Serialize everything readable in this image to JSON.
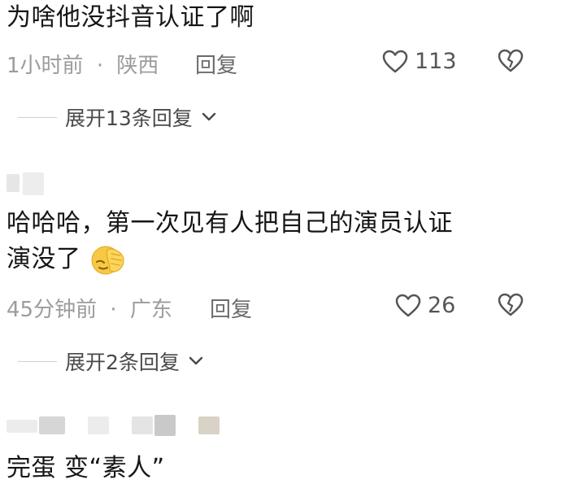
{
  "comments": [
    {
      "text": "为啥他没抖音认证了啊",
      "time": "1小时前",
      "location": "陕西",
      "reply_label": "回复",
      "likes": "113",
      "expand_label": "展开13条回复"
    },
    {
      "text_line1": "哈哈哈，第一次见有人把自己的演员认证",
      "text_line2": "演没了",
      "emoji": "facepalm-emoji",
      "time": "45分钟前",
      "location": "广东",
      "reply_label": "回复",
      "likes": "26",
      "expand_label": "展开2条回复"
    },
    {
      "text": "完蛋 变“素人”"
    }
  ],
  "separator": "·",
  "colors": {
    "heart": "#555555",
    "meta": "#9c9c9c"
  }
}
